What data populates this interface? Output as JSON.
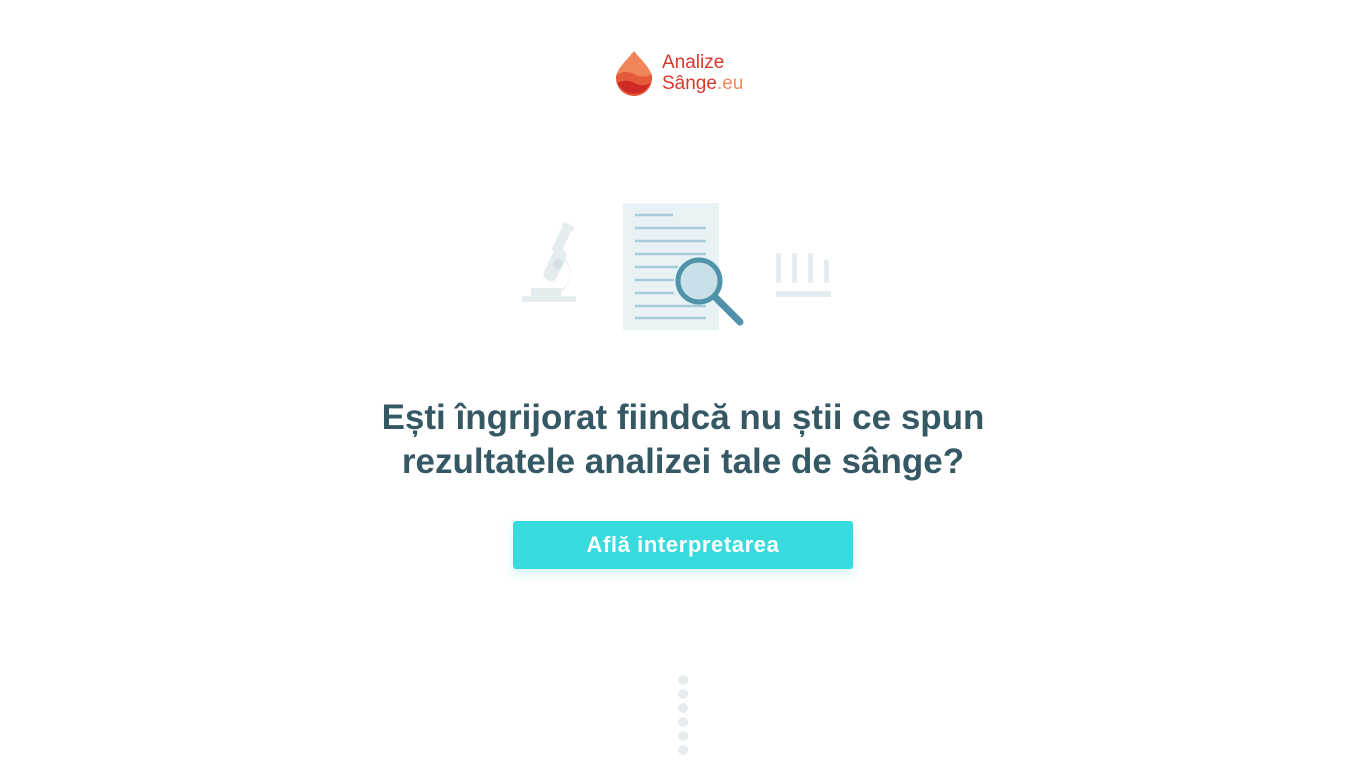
{
  "logo": {
    "line1": "Analize",
    "line2_main": "Sânge",
    "line2_suffix": ".eu",
    "colors": {
      "primary": "#d9382b",
      "secondary": "#ef8a5f"
    }
  },
  "illustration": {
    "icons": [
      "microscope-icon",
      "document-icon",
      "magnifier-icon",
      "test-tubes-icon"
    ]
  },
  "hero": {
    "headline_line1": "Ești îngrijorat fiindcă nu știi ce spun",
    "headline_line2": "rezultatele analizei tale de sânge?",
    "cta_label": "Află interpretarea"
  },
  "colors": {
    "headline": "#355964",
    "cta_background": "#38dbdd",
    "cta_text": "#ffffff",
    "dots": "#e8ecee"
  }
}
